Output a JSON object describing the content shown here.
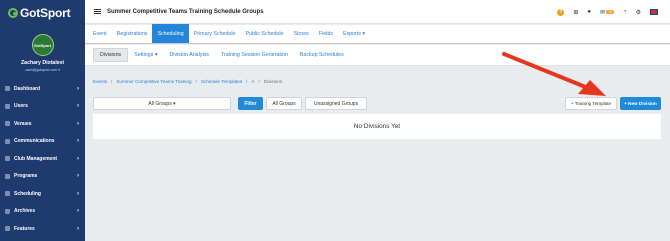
{
  "brand": {
    "name": "GotSport"
  },
  "user": {
    "avatar_text": "GotSport",
    "name": "Zachary Diotalevi",
    "email": "zach@gotsport.com ▾"
  },
  "sidebar": {
    "items": [
      {
        "label": "Dashboard"
      },
      {
        "label": "Users"
      },
      {
        "label": "Venues"
      },
      {
        "label": "Communications"
      },
      {
        "label": "Club Management"
      },
      {
        "label": "Programs"
      },
      {
        "label": "Scheduling"
      },
      {
        "label": "Archives"
      },
      {
        "label": "Features"
      }
    ]
  },
  "header": {
    "title": "Summer Competitive Teams Training Schedule Groups",
    "notification_count": "10"
  },
  "tabs_primary": [
    "Event",
    "Registrations",
    "Scheduling",
    "Primary Schedule",
    "Public Schedule",
    "Stores",
    "Fields",
    "Exports ▾"
  ],
  "tabs_secondary": [
    "Divisions",
    "Settings ▾",
    "Division Analysis",
    "Training Session Generation",
    "Backup Schedules"
  ],
  "breadcrumb": [
    "Events",
    "Summer Competitive Teams Training",
    "Schedule Templates",
    "A",
    "Divisions"
  ],
  "toolbar": {
    "group_select": "All Groups ▾",
    "filter_label": "Filter",
    "all_groups_label": "All Groups",
    "unassigned_label": "Unassigned Groups",
    "training_template_label": "+ Training Template",
    "new_division_label": "+ New Division"
  },
  "panel": {
    "empty_text": "No Divisions Yet"
  },
  "colors": {
    "sidebar": "#1f3a6d",
    "accent": "#1f8ad8",
    "annotation": "#e8351e"
  }
}
